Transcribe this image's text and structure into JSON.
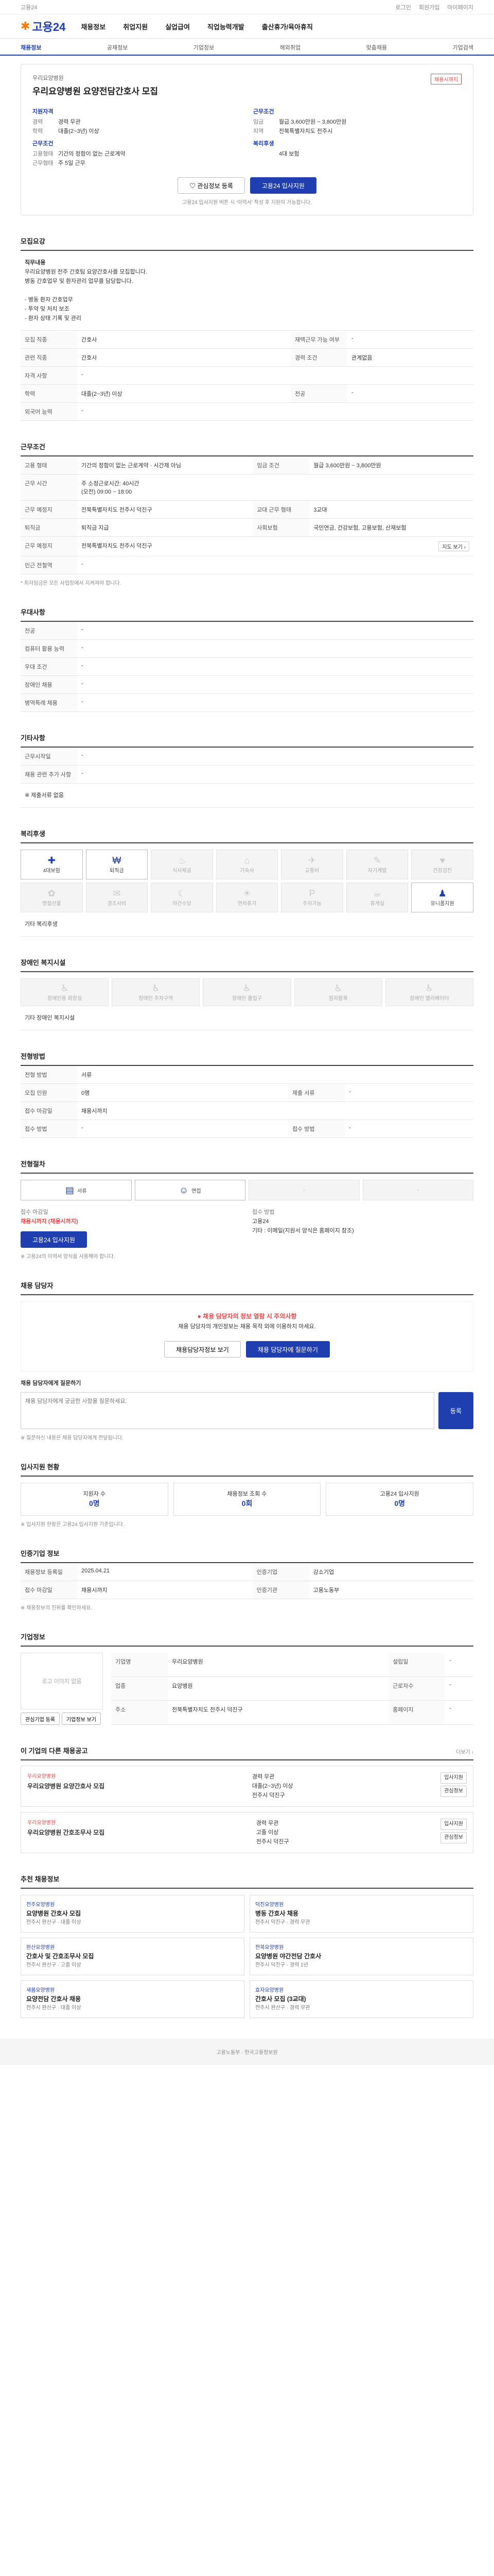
{
  "topbar": {
    "logo_small": "고용24",
    "links": [
      "로그인",
      "회원가입",
      "마이페이지"
    ]
  },
  "header": {
    "logo": "고용24",
    "menu": [
      "채용정보",
      "취업지원",
      "실업급여",
      "직업능력개발",
      "출산휴가/육아휴직"
    ]
  },
  "subnav": {
    "items": [
      "채용정보",
      "공채정보",
      "기업정보",
      "해외취업",
      "맞춤채용",
      "기업검색"
    ],
    "active": "채용정보"
  },
  "job": {
    "company": "우리요양병원",
    "title": "우리요양병원 요양전담간호사 모집",
    "badge": "채용시까지",
    "summary_left_title": "지원자격",
    "summary_left": [
      {
        "k": "경력",
        "v": "경력 무관"
      },
      {
        "k": "학력",
        "v": "대졸(2~3년) 이상"
      }
    ],
    "summary_left_title2": "근무조건",
    "summary_left2": [
      {
        "k": "고용형태",
        "v": "기간의 정함이 없는 근로계약"
      },
      {
        "k": "근무형태",
        "v": "주 5일 근무"
      }
    ],
    "summary_right_title": "근무조건",
    "summary_right": [
      {
        "k": "임금",
        "v": "월급 3,600만원 ~ 3,800만원"
      },
      {
        "k": "지역",
        "v": "전북특별자치도 전주시"
      }
    ],
    "summary_right_title2": "복리후생",
    "summary_right2": [
      {
        "k": "",
        "v": "4대 보험"
      }
    ],
    "btn_scrap": "♡ 관심정보 등록",
    "btn_apply": "고용24 입사지원",
    "note": "고용24 입사지원 버튼 시 ‘이력서’ 작성 후 지원이 가능합니다."
  },
  "sections": {
    "recruit_title": "모집요강",
    "duty_label": "직무내용",
    "duty_text": "우리요양병원 전주 간호팀 요양간호사를 모집합니다.\n병동 간호업무 및 환자관리 업무를 담당합니다.\n\n- 병동 환자 간호업무\n- 투약 및 처치 보조\n- 환자 상태 기록 및 관리",
    "recruit_rows": [
      {
        "k": "모집 직종",
        "v": "간호사",
        "k2": "재택근무 가능 여부",
        "v2": "-"
      },
      {
        "k": "관련 직종",
        "v": "간호사",
        "k2": "경력 조건",
        "v2": "관계없음"
      },
      {
        "k": "자격 사항",
        "v": "-",
        "k2": "",
        "v2": ""
      },
      {
        "k": "학력",
        "v": "대졸(2~3년) 이상",
        "k2": "전공",
        "v2": "-"
      },
      {
        "k": "외국어 능력",
        "v": "-",
        "k2": "",
        "v2": ""
      }
    ],
    "cond_title": "근무조건",
    "cond_rows": [
      {
        "k": "고용 형태",
        "v": "기간의 정함이 없는 근로계약 · 시간제 아님",
        "k2": "임금 조건",
        "v2": "월급 3,600만원 ~ 3,800만원"
      },
      {
        "k": "근무 시간",
        "v": "주 소정근로시간: 40시간\n(오전) 09:00 ~ 18:00",
        "k2": "",
        "v2": ""
      },
      {
        "k": "근무 예정지",
        "v": "전북특별자치도 전주시 덕진구",
        "k2": "교대 근무 형태",
        "v2": "3교대"
      },
      {
        "k": "퇴직금",
        "v": "퇴직금 지급",
        "k2": "사회보험",
        "v2": "국민연금, 건강보험, 고용보험, 산재보험"
      },
      {
        "k": "근무 예정지",
        "v": "전북특별자치도 전주시 덕진구",
        "k2": "",
        "v2": ""
      },
      {
        "k": "인근 전철역",
        "v": "-",
        "k2": "",
        "v2": ""
      }
    ],
    "cond_note": "* 최저임금은 모든 사업장에서 지켜져야 합니다.",
    "pref_title": "우대사항",
    "pref_rows": [
      {
        "k": "전공",
        "v": "-"
      },
      {
        "k": "컴퓨터 활용 능력",
        "v": "-"
      },
      {
        "k": "우대 조건",
        "v": "-"
      },
      {
        "k": "장애인 채용",
        "v": "-"
      },
      {
        "k": "병역특례 채용",
        "v": "-"
      }
    ],
    "etc_title": "기타사항",
    "etc_rows": [
      {
        "k": "근무시작일",
        "v": "-"
      },
      {
        "k": "채용 관련 추가 사항",
        "v": "-"
      }
    ],
    "etc_note": "※ 제출서류 없음",
    "welfare_title": "복리후생",
    "welfare_items": [
      "4대보험",
      "퇴직금",
      "식사제공",
      "기숙사",
      "교통비",
      "자기계발",
      "건강검진",
      "명절선물",
      "경조사비",
      "야간수당",
      "연차휴가",
      "주차가능",
      "휴게실",
      "유니폼지원"
    ],
    "welfare_on": [
      0,
      1,
      13
    ],
    "welfare_note": "기타 복리후생",
    "disab_title": "장애인 복지시설",
    "disab_items": [
      "장애인용 화장실",
      "장애인 주차구역",
      "장애인 출입구",
      "점자블록",
      "장애인 엘리베이터"
    ],
    "disab_note": "기타 장애인 복지시설",
    "apply_title": "전형방법",
    "apply_rows": [
      {
        "k": "전형 방법",
        "v": "서류",
        "k2": "",
        "v2": ""
      },
      {
        "k": "모집 인원",
        "v": "0명",
        "k2": "제출 서류",
        "v2": "-"
      },
      {
        "k": "접수 마감일",
        "v": "채용시까지",
        "k2": "",
        "v2": ""
      },
      {
        "k": "접수 방법",
        "v": "-",
        "k2": "접수 방법",
        "v2": "-"
      }
    ],
    "process_title": "전형절차",
    "process_items": [
      "서류",
      "면접",
      "-",
      "-"
    ],
    "recv_title": "접수방법",
    "recv_left": [
      {
        "k": "접수 마감일",
        "v": "채용시까지 (채용시까지)"
      },
      {
        "k": "",
        "v": ""
      }
    ],
    "recv_right": [
      {
        "k": "접수 방법",
        "v": "고용24"
      },
      {
        "k": "",
        "v": "기타 : 이메일(지원서 양식은 홈페이지 참조)"
      }
    ],
    "recv_btn": "고용24 입사지원",
    "recv_note": "※ 고용24의 이력서 양식을 사용해야 합니다.",
    "cs_title": "채용 담당자",
    "cs_warn": "채용 담당자의 정보 열람 시 주의사항",
    "cs_text": "채용 담당자의 개인정보는 채용 목적 외에 이용하지 마세요.",
    "cs_btn1": "채용담당자정보 보기",
    "cs_btn2": "채용 담당자에 질문하기",
    "qa_title": "채용 담당자에게 질문하기",
    "qa_placeholder": "채용 담당자에게 궁금한 사항을 질문하세요.",
    "qa_btn": "등록",
    "qa_note": "※ 질문하신 내용은 채용 담당자에게 전달됩니다.",
    "status_title": "입사지원 현황",
    "status_boxes": [
      {
        "t": "지원자 수",
        "v": "0명"
      },
      {
        "t": "채용정보 조회 수",
        "v": "0회"
      },
      {
        "t": "고용24 입사지원",
        "v": "0명"
      }
    ],
    "status_note": "※ 입사지원 현황은 고용24 입사지원 기준입니다.",
    "manage_title": "인증기업 정보",
    "manage_rows": [
      {
        "k": "채용정보 등록일",
        "v": "2025.04.21",
        "k2": "인증기업",
        "v2": "강소기업"
      },
      {
        "k": "접수 마감일",
        "v": "채용시까지",
        "k2": "인증기관",
        "v2": "고용노동부"
      }
    ],
    "manage_note": "※ 채용정보의 진위를 확인하세요.",
    "company_title": "기업정보",
    "company_logo": "로고 이미지 없음",
    "company_rows": [
      {
        "k": "기업명",
        "v": "우리요양병원",
        "k2": "설립일",
        "v2": "-"
      },
      {
        "k": "업종",
        "v": "요양병원",
        "k2": "근로자수",
        "v2": "-"
      },
      {
        "k": "주소",
        "v": "전북특별자치도 전주시 덕진구",
        "k2": "홈페이지",
        "v2": "-"
      }
    ],
    "company_btns": [
      "관심기업 등록",
      "기업정보 보기"
    ],
    "similar_title": "이 기업의 다른 채용공고",
    "similar_jobs": [
      {
        "co": "우리요양병원",
        "tt": "우리요양병원 요양간호사 모집",
        "meta": [
          "경력 무관",
          "대졸(2~3년) 이상",
          "전주시 덕진구"
        ],
        "btns": [
          "입사지원",
          "관심정보"
        ]
      },
      {
        "co": "우리요양병원",
        "tt": "우리요양병원 간호조무사 모집",
        "meta": [
          "경력 무관",
          "고졸 이상",
          "전주시 덕진구"
        ],
        "btns": [
          "입사지원",
          "관심정보"
        ]
      }
    ],
    "rec_title": "추천 채용정보",
    "rec_jobs": [
      {
        "co": "전주요양병원",
        "tt": "요양병원 간호사 모집",
        "meta": "전주시 완산구 · 대졸 이상"
      },
      {
        "co": "덕진요양병원",
        "tt": "병동 간호사 채용",
        "meta": "전주시 덕진구 · 경력 무관"
      },
      {
        "co": "완산요양병원",
        "tt": "간호사 및 간호조무사 모집",
        "meta": "전주시 완산구 · 고졸 이상"
      },
      {
        "co": "전북요양병원",
        "tt": "요양병원 야간전담 간호사",
        "meta": "전주시 덕진구 · 경력 1년"
      },
      {
        "co": "새봄요양병원",
        "tt": "요양전담 간호사 채용",
        "meta": "전주시 완산구 · 대졸 이상"
      },
      {
        "co": "효자요양병원",
        "tt": "간호사 모집 (3교대)",
        "meta": "전주시 완산구 · 경력 무관"
      }
    ]
  },
  "footer": {
    "text": "고용노동부 · 한국고용정보원"
  }
}
